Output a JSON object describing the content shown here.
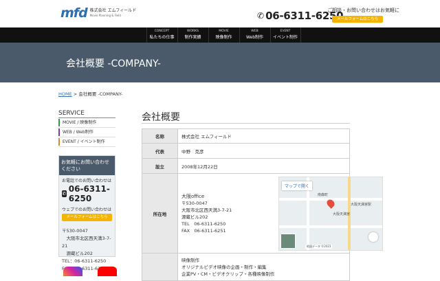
{
  "header": {
    "logo_mark": "mfd",
    "company": "株式会社 エムフィールド",
    "tagline": "Movie Planning & Field",
    "note": "ご相談・お問い合わせはお気軽に",
    "phone": "06-6311-6250",
    "mail_button": "メールフォームはこちら"
  },
  "nav": [
    {
      "en": "CONCEPT",
      "jp": "私たちの仕事"
    },
    {
      "en": "WORKS",
      "jp": "制作実績"
    },
    {
      "en": "MOVIE",
      "jp": "映像制作"
    },
    {
      "en": "WEB",
      "jp": "Web制作"
    },
    {
      "en": "EVENT",
      "jp": "イベント制作"
    }
  ],
  "hero": {
    "title": "会社概要 -COMPANY-"
  },
  "breadcrumb": {
    "home": "HOME",
    "sep": " > ",
    "current": "会社概要 -COMPANY-"
  },
  "sidebar": {
    "title": "SERVICE",
    "items": [
      {
        "label": "MOVIE / 映像制作",
        "color": "#2e9e44"
      },
      {
        "label": "WEB / Web制作",
        "color": "#7b3fa0"
      },
      {
        "label": "EVENT / イベント制作",
        "color": "#e08a1e"
      }
    ]
  },
  "contact": {
    "heading": "お気軽にお問い合わせください",
    "phone_label": "お電話でのお問い合わせは",
    "phone": "06-6311-6250",
    "web_label": "ウェブでのお問い合わせは",
    "mail_button": "メールフォームはこちら",
    "address": [
      "〒530-0047",
      "　大阪市北区西天満3-7-21",
      "　源蔵ビル202",
      "TEL：06-6311-6250",
      "FAX：06-6311-6251"
    ]
  },
  "main": {
    "title": "会社概要",
    "rows": [
      {
        "key": "名称",
        "value": "株式会社 エムフィールド"
      },
      {
        "key": "代表",
        "value": "中野　克彦"
      },
      {
        "key": "設立",
        "value": "2008年12月22日"
      },
      {
        "key": "所在地",
        "lines": [
          "大阪office",
          "〒530-0047",
          "大阪市北区西天満3-7-21",
          "源蔵ビル202",
          "TEL　06-6311-6250",
          "FAX　06-6311-6251"
        ]
      }
    ],
    "business_lines": [
      "映像制作",
      "オリジナルビデオ映像の企画・制作・編集",
      "企業PV・CM・ビデオクリップ・各種映像制作"
    ]
  },
  "map": {
    "open_label": "マップで開く",
    "labels": [
      "南森町",
      "大阪天満宮",
      "大阪天満宮駅"
    ],
    "footer": "地図データ ©2023"
  },
  "social": [
    {
      "name": "instagram",
      "color": "#d6249f"
    },
    {
      "name": "youtube",
      "color": "#ff0000"
    }
  ],
  "colors": {
    "brand": "#2e6fb0",
    "accent": "#f4b400",
    "hero": "#4a5a6a"
  }
}
